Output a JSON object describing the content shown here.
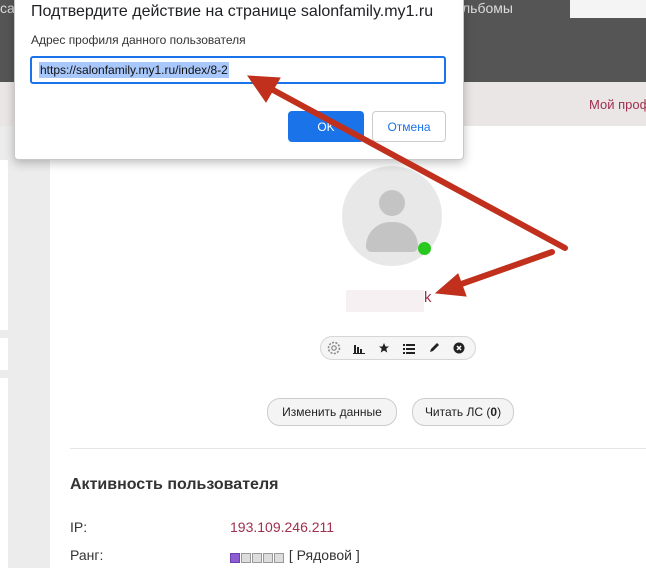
{
  "topbar": {
    "nav_left": "са",
    "nav_item": "льбомы"
  },
  "subbar": {
    "my_profile": "Мой проф"
  },
  "profile": {
    "username_tail": "k",
    "toolbar_icons": [
      "gear-icon",
      "stats-icon",
      "star-icon",
      "list-icon",
      "pencil-icon",
      "close-icon"
    ]
  },
  "actions": {
    "edit_label": "Изменить данные",
    "read_label_prefix": "Читать ЛС (",
    "read_count": "0",
    "read_label_suffix": ")"
  },
  "activity": {
    "title": "Активность пользователя",
    "ip_label": "IP:",
    "ip_value": "193.109.246.211",
    "rank_label": "Ранг:",
    "rank_filled": 1,
    "rank_total": 5,
    "rank_value": "[ Рядовой ]"
  },
  "dialog": {
    "title": "Подтвердите действие на странице salonfamily.my1.ru",
    "label": "Адрес профиля данного пользователя",
    "input_value": "https://salonfamily.my1.ru/index/8-2",
    "ok_label": "OK",
    "cancel_label": "Отмена"
  },
  "colors": {
    "accent": "#a0304e",
    "arrow": "#c0301d",
    "button_blue": "#1a73e8",
    "online": "#28c81e"
  }
}
